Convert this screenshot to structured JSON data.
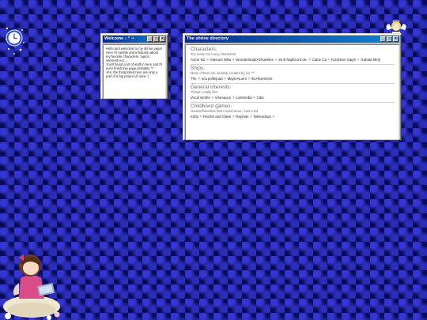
{
  "welcome": {
    "title": "Welcome ♪ ° ·•",
    "paragraphs": [
      "Hello and welcome to my shrine page!",
      "Here I'll ramble and infodump about my favorite characters, topics, interests ecc...",
      "You'll found a lot of stuff in here and I'll even finish this page probably ^^",
      "Yes, the thing listed here are only a part of a big project of mine :)"
    ]
  },
  "shrine": {
    "title": "The shrine directory",
    "sections": [
      {
        "heading": "Characters:",
        "subtitle": "Too many too many characters",
        "items": "Acme Iku ✧ Hatsune Miku ✧ Wonderlands×Showtime ✧ 25 & Nightcord de. ✧ Calne Ca ✧ Kotohime Sagiri ✧ Gahata Meiji"
      },
      {
        "heading": "Ships:",
        "subtitle": "Most of them are rareship created by me ^^'",
        "items": "The ✧ oca pollinjuad ✧ Majiro×Lumi ✧ Iku×Evestone"
      },
      {
        "heading": "General interests:",
        "subtitle": "Things I really like!",
        "items": "Vocal synths ✧ Vinesauce ✧ Lostmedia ✧ Cats"
      },
      {
        "heading": "Childhood games:",
        "subtitle": "Games/franchise that I loved since I was a kid",
        "items": "Kirby ✧ Rachet and Clank ✧ Rayman ✧ Nintendogs ✧"
      }
    ]
  },
  "colors": {
    "desktop": "#10127a",
    "titlebar_start": "#0a2a8e",
    "titlebar_end": "#1084d0",
    "window_face": "#c0c0c0"
  },
  "icons": {
    "clock": "clock-decoration-icon",
    "angel": "angel-doll-decoration-icon",
    "girl": "girl-with-laptop-decoration"
  }
}
